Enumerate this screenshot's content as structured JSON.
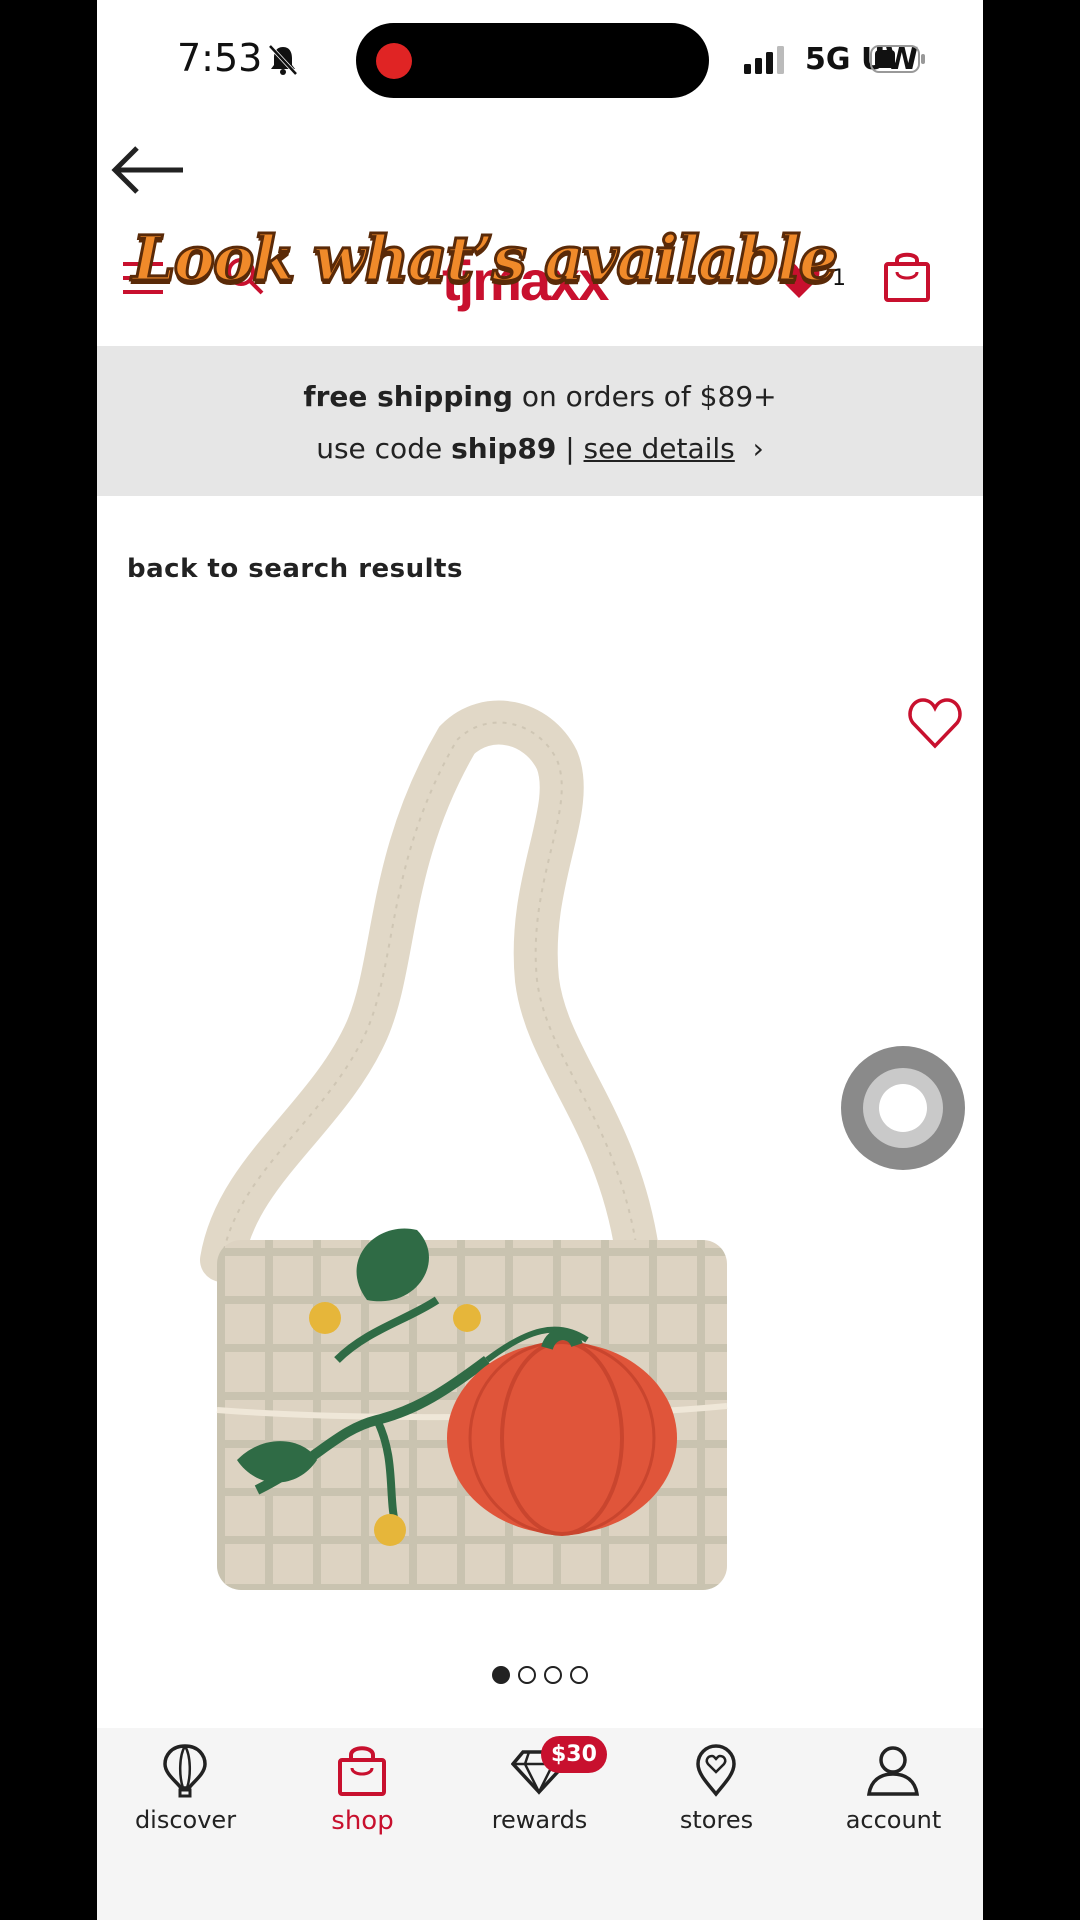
{
  "status_bar": {
    "time": "7:53",
    "network": "5G UW"
  },
  "header": {
    "overlay_caption": "Look what’s available",
    "logo": "tjmaxx",
    "wishlist_count": "1"
  },
  "promo": {
    "line1_bold": "free shipping",
    "line1_rest": " on orders of $89+",
    "line2_prefix": "use code ",
    "line2_code": "ship89",
    "line2_sep": " | ",
    "details_link": "see details",
    "chevron": "›"
  },
  "back_link": "back to search results",
  "product": {
    "image_count": 4,
    "active_image": 1,
    "colors": {
      "pumpkin": "#e0553a",
      "leaf": "#2f6b45",
      "flower": "#e6b63a",
      "bead_base": "#ddd3c2"
    }
  },
  "bottom_nav": {
    "items": [
      {
        "label": "discover",
        "icon": "balloon-icon"
      },
      {
        "label": "shop",
        "icon": "shopping-bag-icon",
        "active": true
      },
      {
        "label": "rewards",
        "icon": "diamond-icon",
        "badge": "$30"
      },
      {
        "label": "stores",
        "icon": "location-pin-icon"
      },
      {
        "label": "account",
        "icon": "person-icon"
      }
    ]
  },
  "colors": {
    "brand": "#c8102e",
    "promo_bg": "#e6e6e6",
    "nav_bg": "#f5f5f5"
  }
}
